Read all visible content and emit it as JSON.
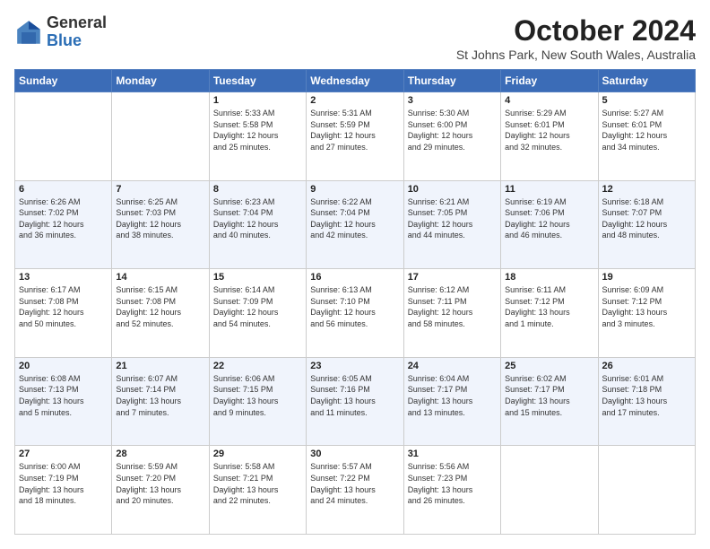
{
  "logo": {
    "general": "General",
    "blue": "Blue"
  },
  "header": {
    "month": "October 2024",
    "location": "St Johns Park, New South Wales, Australia"
  },
  "weekdays": [
    "Sunday",
    "Monday",
    "Tuesday",
    "Wednesday",
    "Thursday",
    "Friday",
    "Saturday"
  ],
  "weeks": [
    [
      {
        "day": "",
        "info": ""
      },
      {
        "day": "",
        "info": ""
      },
      {
        "day": "1",
        "info": "Sunrise: 5:33 AM\nSunset: 5:58 PM\nDaylight: 12 hours\nand 25 minutes."
      },
      {
        "day": "2",
        "info": "Sunrise: 5:31 AM\nSunset: 5:59 PM\nDaylight: 12 hours\nand 27 minutes."
      },
      {
        "day": "3",
        "info": "Sunrise: 5:30 AM\nSunset: 6:00 PM\nDaylight: 12 hours\nand 29 minutes."
      },
      {
        "day": "4",
        "info": "Sunrise: 5:29 AM\nSunset: 6:01 PM\nDaylight: 12 hours\nand 32 minutes."
      },
      {
        "day": "5",
        "info": "Sunrise: 5:27 AM\nSunset: 6:01 PM\nDaylight: 12 hours\nand 34 minutes."
      }
    ],
    [
      {
        "day": "6",
        "info": "Sunrise: 6:26 AM\nSunset: 7:02 PM\nDaylight: 12 hours\nand 36 minutes."
      },
      {
        "day": "7",
        "info": "Sunrise: 6:25 AM\nSunset: 7:03 PM\nDaylight: 12 hours\nand 38 minutes."
      },
      {
        "day": "8",
        "info": "Sunrise: 6:23 AM\nSunset: 7:04 PM\nDaylight: 12 hours\nand 40 minutes."
      },
      {
        "day": "9",
        "info": "Sunrise: 6:22 AM\nSunset: 7:04 PM\nDaylight: 12 hours\nand 42 minutes."
      },
      {
        "day": "10",
        "info": "Sunrise: 6:21 AM\nSunset: 7:05 PM\nDaylight: 12 hours\nand 44 minutes."
      },
      {
        "day": "11",
        "info": "Sunrise: 6:19 AM\nSunset: 7:06 PM\nDaylight: 12 hours\nand 46 minutes."
      },
      {
        "day": "12",
        "info": "Sunrise: 6:18 AM\nSunset: 7:07 PM\nDaylight: 12 hours\nand 48 minutes."
      }
    ],
    [
      {
        "day": "13",
        "info": "Sunrise: 6:17 AM\nSunset: 7:08 PM\nDaylight: 12 hours\nand 50 minutes."
      },
      {
        "day": "14",
        "info": "Sunrise: 6:15 AM\nSunset: 7:08 PM\nDaylight: 12 hours\nand 52 minutes."
      },
      {
        "day": "15",
        "info": "Sunrise: 6:14 AM\nSunset: 7:09 PM\nDaylight: 12 hours\nand 54 minutes."
      },
      {
        "day": "16",
        "info": "Sunrise: 6:13 AM\nSunset: 7:10 PM\nDaylight: 12 hours\nand 56 minutes."
      },
      {
        "day": "17",
        "info": "Sunrise: 6:12 AM\nSunset: 7:11 PM\nDaylight: 12 hours\nand 58 minutes."
      },
      {
        "day": "18",
        "info": "Sunrise: 6:11 AM\nSunset: 7:12 PM\nDaylight: 13 hours\nand 1 minute."
      },
      {
        "day": "19",
        "info": "Sunrise: 6:09 AM\nSunset: 7:12 PM\nDaylight: 13 hours\nand 3 minutes."
      }
    ],
    [
      {
        "day": "20",
        "info": "Sunrise: 6:08 AM\nSunset: 7:13 PM\nDaylight: 13 hours\nand 5 minutes."
      },
      {
        "day": "21",
        "info": "Sunrise: 6:07 AM\nSunset: 7:14 PM\nDaylight: 13 hours\nand 7 minutes."
      },
      {
        "day": "22",
        "info": "Sunrise: 6:06 AM\nSunset: 7:15 PM\nDaylight: 13 hours\nand 9 minutes."
      },
      {
        "day": "23",
        "info": "Sunrise: 6:05 AM\nSunset: 7:16 PM\nDaylight: 13 hours\nand 11 minutes."
      },
      {
        "day": "24",
        "info": "Sunrise: 6:04 AM\nSunset: 7:17 PM\nDaylight: 13 hours\nand 13 minutes."
      },
      {
        "day": "25",
        "info": "Sunrise: 6:02 AM\nSunset: 7:17 PM\nDaylight: 13 hours\nand 15 minutes."
      },
      {
        "day": "26",
        "info": "Sunrise: 6:01 AM\nSunset: 7:18 PM\nDaylight: 13 hours\nand 17 minutes."
      }
    ],
    [
      {
        "day": "27",
        "info": "Sunrise: 6:00 AM\nSunset: 7:19 PM\nDaylight: 13 hours\nand 18 minutes."
      },
      {
        "day": "28",
        "info": "Sunrise: 5:59 AM\nSunset: 7:20 PM\nDaylight: 13 hours\nand 20 minutes."
      },
      {
        "day": "29",
        "info": "Sunrise: 5:58 AM\nSunset: 7:21 PM\nDaylight: 13 hours\nand 22 minutes."
      },
      {
        "day": "30",
        "info": "Sunrise: 5:57 AM\nSunset: 7:22 PM\nDaylight: 13 hours\nand 24 minutes."
      },
      {
        "day": "31",
        "info": "Sunrise: 5:56 AM\nSunset: 7:23 PM\nDaylight: 13 hours\nand 26 minutes."
      },
      {
        "day": "",
        "info": ""
      },
      {
        "day": "",
        "info": ""
      }
    ]
  ]
}
